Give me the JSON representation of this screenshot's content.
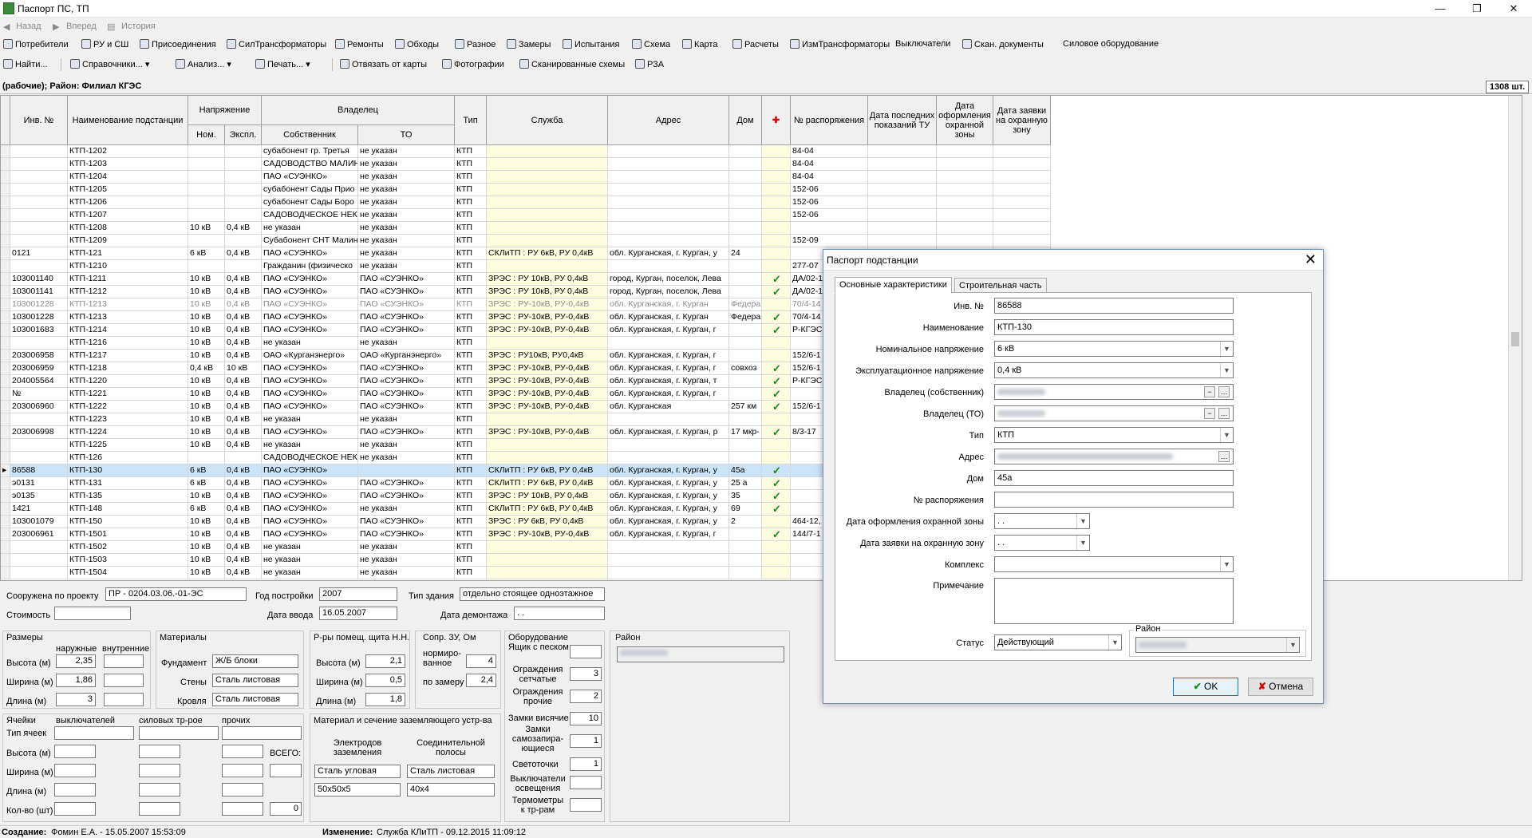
{
  "window": {
    "title": "Паспорт ПС, ТП",
    "min": "—",
    "max": "❐",
    "close": "✕"
  },
  "nav": {
    "back": "Назад",
    "forward": "Вперед",
    "history": "История"
  },
  "toolbar1": [
    "Потребители",
    "РУ и СШ",
    "Присоединения",
    "СилТрансформаторы",
    "Ремонты",
    "Обходы",
    "Разное",
    "Замеры",
    "Испытания",
    "Схема",
    "Карта",
    "Расчеты",
    "ИзмТрансформаторы",
    "Выключатели",
    "Скан. документы",
    "Силовое оборудование"
  ],
  "toolbar2": {
    "find": "Найти...",
    "dicts": "Справочники...",
    "anal": "Анализ...",
    "print": "Печать...",
    "unbind": "Отвязать от карты",
    "photos": "Фотографии",
    "schemes": "Сканированные схемы",
    "rza": "РЗА"
  },
  "info": {
    "left": "(рабочие); Район: Филиал КГЭС",
    "count": "1308 шт."
  },
  "grid": {
    "headers": {
      "inv": "Инв. №",
      "name": "Наименование подстанции",
      "voltage": "Напряжение",
      "nom": "Ном.",
      "expl": "Экспл.",
      "owner": "Владелец",
      "owner_own": "Собственник",
      "owner_to": "ТО",
      "type": "Тип",
      "service": "Служба",
      "address": "Адрес",
      "house": "Дом",
      "pin": "✚",
      "order": "№ распоряжения",
      "date_tu": "Дата последних показаний ТУ",
      "date_zone": "Дата оформления охранной зоны",
      "date_req": "Дата заявки на охранную зону"
    },
    "rows": [
      [
        "",
        "КТП-1202",
        "",
        "",
        "субабонент гр. Третья",
        "не указан",
        "КТП",
        "",
        "",
        "",
        "",
        "84-04"
      ],
      [
        "",
        "КТП-1203",
        "",
        "",
        "САДОВОДСТВО МАЛИН",
        "не указан",
        "КТП",
        "",
        "",
        "",
        "",
        "84-04"
      ],
      [
        "",
        "КТП-1204",
        "",
        "",
        "ПАО «СУЭНКО»",
        "не указан",
        "КТП",
        "",
        "",
        "",
        "",
        "84-04"
      ],
      [
        "",
        "КТП-1205",
        "",
        "",
        "субабонент Сады Прио",
        "не указан",
        "КТП",
        "",
        "",
        "",
        "",
        "152-06"
      ],
      [
        "",
        "КТП-1206",
        "",
        "",
        "субабонент Сады Боро",
        "не указан",
        "КТП",
        "",
        "",
        "",
        "",
        "152-06"
      ],
      [
        "",
        "КТП-1207",
        "",
        "",
        "САДОВОДЧЕСКОЕ НЕК",
        "не указан",
        "КТП",
        "",
        "",
        "",
        "",
        "152-06"
      ],
      [
        "",
        "КТП-1208",
        "10 кВ",
        "0,4 кВ",
        "не указан",
        "не указан",
        "КТП",
        "",
        "",
        "",
        "",
        ""
      ],
      [
        "",
        "КТП-1209",
        "",
        "",
        "Субабонент СНТ Малин",
        "не указан",
        "КТП",
        "",
        "",
        "",
        "",
        "152-09"
      ],
      [
        "0121",
        "КТП-121",
        "6 кВ",
        "0,4 кВ",
        "ПАО «СУЭНКО»",
        "не указан",
        "КТП",
        "СКЛиТП : РУ 6кВ, РУ 0,4кВ",
        "обл. Курганская, г. Курган, у",
        "24",
        "",
        ""
      ],
      [
        "",
        "КТП-1210",
        "",
        "",
        "Гражданин (физическо",
        "не указан",
        "КТП",
        "",
        "",
        "",
        "",
        "277-07"
      ],
      [
        "103001140",
        "КТП-1211",
        "10 кВ",
        "0,4 кВ",
        "ПАО «СУЭНКО»",
        "ПАО «СУЭНКО»",
        "КТП",
        "ЗРЭС : РУ 10кВ, РУ 0,4кВ",
        "город, Курган, поселок, Лева",
        "",
        "✓",
        "ДА/02-1"
      ],
      [
        "103001141",
        "КТП-1212",
        "10 кВ",
        "0,4 кВ",
        "ПАО «СУЭНКО»",
        "ПАО «СУЭНКО»",
        "КТП",
        "ЗРЭС : РУ 10кВ, РУ 0,4кВ",
        "город, Курган, поселок, Лева",
        "",
        "✓",
        "ДА/02-1"
      ],
      [
        "103001228",
        "КТП-1213",
        "10 кВ",
        "0,4 кВ",
        "ПАО «СУЭНКО»",
        "ПАО «СУЭНКО»",
        "КТП",
        "ЗРЭС : РУ-10кВ, РУ-0,4кВ",
        "обл. Курганская, г. Курган",
        "Федера",
        "",
        "70/4-14"
      ],
      [
        "103001228",
        "КТП-1213",
        "10 кВ",
        "0,4 кВ",
        "ПАО «СУЭНКО»",
        "ПАО «СУЭНКО»",
        "КТП",
        "ЗРЭС : РУ-10кВ, РУ-0,4кВ",
        "обл. Курганская, г. Курган",
        "Федера",
        "✓",
        "70/4-14"
      ],
      [
        "103001683",
        "КТП-1214",
        "10 кВ",
        "0,4 кВ",
        "ПАО «СУЭНКО»",
        "ПАО «СУЭНКО»",
        "КТП",
        "ЗРЭС : РУ-10кВ, РУ-0,4кВ",
        "обл. Курганская, г. Курган, г",
        "",
        "✓",
        "Р-КГЭС-"
      ],
      [
        "",
        "КТП-1216",
        "10 кВ",
        "0,4 кВ",
        "не указан",
        "не указан",
        "КТП",
        "",
        "",
        "",
        "",
        ""
      ],
      [
        "203006958",
        "КТП-1217",
        "10 кВ",
        "0,4 кВ",
        "ОАО «Курганэнерго»",
        "ОАО «Курганэнерго»",
        "КТП",
        "ЗРЭС : РУ10кВ, РУ0,4кВ",
        "обл. Курганская, г. Курган, г",
        "",
        "",
        "152/6-1"
      ],
      [
        "203006959",
        "КТП-1218",
        "0,4 кВ",
        "10 кВ",
        "ПАО «СУЭНКО»",
        "ПАО «СУЭНКО»",
        "КТП",
        "ЗРЭС : РУ-10кВ, РУ-0,4кВ",
        "обл. Курганская, г. Курган, г",
        "совхоз",
        "✓",
        "152/6-1"
      ],
      [
        "204005564",
        "КТП-1220",
        "10 кВ",
        "0,4 кВ",
        "ПАО «СУЭНКО»",
        "ПАО «СУЭНКО»",
        "КТП",
        "ЗРЭС : РУ-10кВ, РУ-0,4кВ",
        "обл. Курганская, г. Курган, т",
        "",
        "✓",
        "Р-КГЭС-"
      ],
      [
        "№",
        "КТП-1221",
        "10 кВ",
        "0,4 кВ",
        "ПАО «СУЭНКО»",
        "ПАО «СУЭНКО»",
        "КТП",
        "ЗРЭС : РУ-10кВ, РУ-0,4кВ",
        "обл. Курганская, г. Курган, г",
        "",
        "✓",
        ""
      ],
      [
        "203006960",
        "КТП-1222",
        "10 кВ",
        "0,4 кВ",
        "ПАО «СУЭНКО»",
        "ПАО «СУЭНКО»",
        "КТП",
        "ЗРЭС : РУ-10кВ, РУ-0,4кВ",
        "обл. Курганская",
        "257 км",
        "✓",
        "152/6-1"
      ],
      [
        "",
        "КТП-1223",
        "10 кВ",
        "0,4 кВ",
        "не указан",
        "не указан",
        "КТП",
        "",
        "",
        "",
        "",
        ""
      ],
      [
        "203006998",
        "КТП-1224",
        "10 кВ",
        "0,4 кВ",
        "ПАО «СУЭНКО»",
        "ПАО «СУЭНКО»",
        "КТП",
        "ЗРЭС : РУ-10кВ, РУ-0,4кВ",
        "обл. Курганская, г. Курган, р",
        "17 мкр-",
        "✓",
        "8/3-17"
      ],
      [
        "",
        "КТП-1225",
        "10 кВ",
        "0,4 кВ",
        "не указан",
        "не указан",
        "КТП",
        "",
        "",
        "",
        "",
        ""
      ],
      [
        "",
        "КТП-126",
        "",
        "",
        "САДОВОДЧЕСКОЕ НЕК",
        "не указан",
        "КТП",
        "",
        "",
        "",
        "",
        ""
      ],
      [
        "86588",
        "КТП-130",
        "6 кВ",
        "0,4 кВ",
        "ПАО «СУЭНКО»",
        "",
        "КТП",
        "СКЛиТП : РУ 6кВ, РУ 0,4кВ",
        "обл. Курганская, г. Курган, у",
        "45а",
        "✓",
        ""
      ],
      [
        "э0131",
        "КТП-131",
        "6 кВ",
        "0,4 кВ",
        "ПАО «СУЭНКО»",
        "ПАО «СУЭНКО»",
        "КТП",
        "СКЛиТП : РУ 6кВ, РУ 0,4кВ",
        "обл. Курганская, г. Курган, у",
        "25 а",
        "✓",
        ""
      ],
      [
        "э0135",
        "КТП-135",
        "10 кВ",
        "0,4 кВ",
        "ПАО «СУЭНКО»",
        "ПАО «СУЭНКО»",
        "КТП",
        "ЗРЭС : РУ 10кВ, РУ 0,4кВ",
        "обл. Курганская, г. Курган, у",
        "35",
        "✓",
        ""
      ],
      [
        "1421",
        "КТП-148",
        "6 кВ",
        "0,4 кВ",
        "ПАО «СУЭНКО»",
        "не указан",
        "КТП",
        "СКЛиТП : РУ 6кВ, РУ 0,4кВ",
        "обл. Курганская, г. Курган, у",
        "69",
        "✓",
        ""
      ],
      [
        "103001079",
        "КТП-150",
        "10 кВ",
        "0,4 кВ",
        "ПАО «СУЭНКО»",
        "ПАО «СУЭНКО»",
        "КТП",
        "ЗРЭС : РУ 6кВ, РУ 0,4кВ",
        "обл. Курганская, г. Курган, у",
        "2",
        "",
        "464-12,"
      ],
      [
        "203006961",
        "КТП-1501",
        "10 кВ",
        "0,4 кВ",
        "ПАО «СУЭНКО»",
        "ПАО «СУЭНКО»",
        "КТП",
        "ЗРЭС : РУ-10кВ, РУ-0,4кВ",
        "обл. Курганская, г. Курган, г",
        "",
        "✓",
        "144/7-1"
      ],
      [
        "",
        "КТП-1502",
        "10 кВ",
        "0,4 кВ",
        "не указан",
        "не указан",
        "КТП",
        "",
        "",
        "",
        "",
        ""
      ],
      [
        "",
        "КТП-1503",
        "10 кВ",
        "0,4 кВ",
        "не указан",
        "не указан",
        "КТП",
        "",
        "",
        "",
        "",
        ""
      ],
      [
        "",
        "КТП-1504",
        "10 кВ",
        "0,4 кВ",
        "не указан",
        "не указан",
        "КТП",
        "",
        "",
        "",
        "",
        ""
      ]
    ]
  },
  "bottom": {
    "built_by_project_lbl": "Сооружена по проекту",
    "built_by_project": "ПР - 0204.03.06.-01-ЭС",
    "year_lbl": "Год постройки",
    "year": "2007",
    "bldg_type_lbl": "Тип здания",
    "bldg_type": "отдельно стоящее одноэтажное",
    "cost_lbl": "Стоимость",
    "cost": "",
    "date_in_lbl": "Дата ввода",
    "date_in": "16.05.2007",
    "date_dem_lbl": "Дата демонтажа",
    "date_dem": ". .",
    "sizes_lbl": "Размеры",
    "outer_lbl": "наружные",
    "inner_lbl": "внутренние",
    "h_lbl": "Высота (м)",
    "w_lbl": "Ширина (м)",
    "l_lbl": "Длина (м)",
    "h_out": "2,35",
    "w_out": "1,86",
    "l_out": "3",
    "materials_lbl": "Материалы",
    "found_lbl": "Фундамент",
    "found": "Ж/Б блоки",
    "walls_lbl": "Стены",
    "walls": "Сталь листовая",
    "roof_lbl": "Кровля",
    "roof": "Сталь листовая",
    "shield_lbl": "Р-ры помещ. щита Н.Н.",
    "sh_h": "2,1",
    "sh_w": "0,5",
    "sh_l": "1,8",
    "resist_lbl": "Сопр. ЗУ, Ом",
    "norm_lbl": "нормиро- ванное",
    "norm": "4",
    "meas_lbl": "по замеру",
    "meas": "2,4",
    "equip_lbl": "Оборудование",
    "sand_lbl": "Ящик с песком",
    "sand": "",
    "mesh_lbl": "Ограждения сетчатые",
    "mesh": "3",
    "other_fence_lbl": "Ограждения прочие",
    "other_fence": "2",
    "locks_lbl": "Замки висячие",
    "locks": "10",
    "selflocks_lbl": "Замки самозапира- ющиеся",
    "selflocks": "1",
    "lights_lbl": "Светоточки",
    "lights": "1",
    "lightsw_lbl": "Выключатели освещения",
    "lightsw": "",
    "thermo_lbl": "Термометры к тр-рам",
    "thermo": "",
    "region_lbl": "Район",
    "cells_lbl": "Ячейки",
    "breakers_lbl": "выключателей",
    "trans_lbl": "силовых тр-рое",
    "other_lbl": "прочих",
    "celltype_lbl": "Тип ячеек",
    "total_lbl": "ВСЕГО:",
    "qty_lbl": "Кол-во (шт)",
    "total": "0",
    "ground_lbl": "Материал и сечение заземляющего устр-ва",
    "electrode_lbl": "Электродов заземления",
    "strip_lbl": "Соединительной полосы",
    "electrode": "Сталь угловая",
    "strip": "Сталь листовая",
    "electrode2": "50x50x5",
    "strip2": "40x4"
  },
  "status": {
    "created_lbl": "Создание:",
    "created": "Фомин Е.А. - 15.05.2007 15:53:09",
    "changed_lbl": "Изменение:",
    "changed": "Служба КЛиТП - 09.12.2015 11:09:12"
  },
  "dialog": {
    "title": "Паспорт подстанции",
    "close": "✕",
    "tab1": "Основные характеристики",
    "tab2": "Строительная часть",
    "inv_lbl": "Инв. №",
    "inv": "86588",
    "name_lbl": "Наименование",
    "name": "КТП-130",
    "nom_lbl": "Номинальное напряжение",
    "nom": "6 кВ",
    "expl_lbl": "Эксплуатационное напряжение",
    "expl": "0,4 кВ",
    "own_lbl": "Владелец (собственник)",
    "to_lbl": "Владелец (ТО)",
    "type_lbl": "Тип",
    "type": "КТП",
    "addr_lbl": "Адрес",
    "house_lbl": "Дом",
    "house": "45а",
    "order_lbl": "№ распоряжения",
    "order": "",
    "zone_lbl": "Дата оформления охранной зоны",
    "zone": ". .",
    "req_lbl": "Дата заявки на охранную зону",
    "req": ". .",
    "complex_lbl": "Комплекс",
    "complex": "",
    "note_lbl": "Примечание",
    "note": "",
    "status_lbl": "Статус",
    "status": "Действующий",
    "region_lbl": "Район",
    "ok": "OK",
    "cancel": "Отмена"
  }
}
